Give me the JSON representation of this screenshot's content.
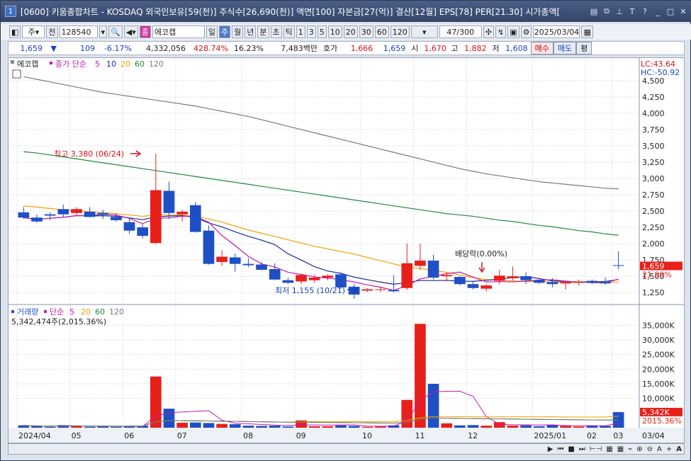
{
  "window": {
    "number": "1",
    "title": "[0600] 키움종합차트 - KOSDAQ 외국인보유[59(천)] 주식수[26,690(천)] 액면[100] 자본금[27(억)] 결산[12월] EPS[78] PER[21.30] 시가총액[",
    "buttons": [
      "doc-icon",
      "restore-icon",
      "pin-icon",
      "T",
      "?",
      "_",
      "□",
      "×"
    ]
  },
  "toolbar": {
    "period_type": "주",
    "prev": "전",
    "code": "128540",
    "name": "에코캡",
    "name_tag": "종",
    "intervals": [
      "일",
      "주",
      "월",
      "년"
    ],
    "selected_interval": "주",
    "minute_types": [
      "분",
      "초",
      "틱"
    ],
    "numbers": [
      "1",
      "3",
      "5",
      "10",
      "20",
      "30",
      "60",
      "120"
    ],
    "count": "47",
    "count_total": "/300",
    "date": "2025/03/04"
  },
  "info": {
    "price": "1,659",
    "arrow": "▼",
    "change": "109",
    "change_pct": "-6.17%",
    "volume": "4,332,056",
    "vol_pct": "428.74%",
    "turnover": "16.23%",
    "amount": "7,483백만",
    "hoga_label": "호가",
    "hoga1": "1,666",
    "hoga2": "1,659",
    "open_label": "시",
    "open": "1,670",
    "high_label": "고",
    "high": "1,882",
    "low_label": "저",
    "low": "1,608",
    "buy": "매수",
    "sell": "매도",
    "eval": "평"
  },
  "price_panel": {
    "name": "에코캡",
    "ma_label": "종가 단순",
    "ma_periods": [
      "5",
      "10",
      "20",
      "60",
      "120"
    ],
    "lc": "LC:43.64",
    "hc": "HC:-50.92",
    "high_note": "최고 3,380 (06/24)",
    "low_note": "최저 1,155 (10/21)",
    "dividend_note": "배당락(0.00%)",
    "current_price": "1,659",
    "current_pct": "21.99%",
    "ticks": [
      "4,500",
      "4,250",
      "4,000",
      "3,750",
      "3,500",
      "3,250",
      "3,000",
      "2,750",
      "2,500",
      "2,250",
      "2,000",
      "1,750",
      "1,500",
      "1,250"
    ]
  },
  "volume_panel": {
    "label": "거래량",
    "ma_label": "단순",
    "ma_periods": [
      "5",
      "20",
      "60",
      "120"
    ],
    "value_text": "5,342,474주(2,015.36%)",
    "current": "5,342K",
    "current_pct": "2015.36%",
    "ticks": [
      "35,000K",
      "30,000K",
      "25,000K",
      "20,000K",
      "15,000K",
      "10,000K"
    ]
  },
  "xaxis": {
    "labels": [
      "2024/04",
      "05",
      "06",
      "07",
      "08",
      "09",
      "10",
      "11",
      "12",
      "2025/01",
      "02",
      "03"
    ],
    "last": "03/04"
  },
  "colors": {
    "up": "#e8201a",
    "down": "#1f4fc4",
    "ma5": "#c21ab0",
    "ma10": "#1a2a9c",
    "ma20": "#f0a000",
    "ma60": "#1f8a3a",
    "ma120": "#7a7a7a"
  },
  "chart_data": {
    "type": "candlestick",
    "candles": [
      [
        2480,
        2560,
        2380,
        2400
      ],
      [
        2400,
        2450,
        2320,
        2340
      ],
      [
        2450,
        2480,
        2360,
        2430
      ],
      [
        2530,
        2600,
        2400,
        2450
      ],
      [
        2470,
        2560,
        2420,
        2530
      ],
      [
        2490,
        2560,
        2400,
        2410
      ],
      [
        2470,
        2520,
        2380,
        2440
      ],
      [
        2410,
        2460,
        2340,
        2360
      ],
      [
        2330,
        2380,
        2150,
        2200
      ],
      [
        2250,
        2300,
        2080,
        2120
      ],
      [
        2010,
        3380,
        1990,
        2820
      ],
      [
        2810,
        2950,
        2380,
        2470
      ],
      [
        2450,
        2520,
        2340,
        2490
      ],
      [
        2590,
        2640,
        2170,
        2180
      ],
      [
        2200,
        2280,
        1680,
        1690
      ],
      [
        1720,
        1900,
        1660,
        1800
      ],
      [
        1790,
        1850,
        1570,
        1690
      ],
      [
        1690,
        1780,
        1640,
        1670
      ],
      [
        1680,
        1720,
        1590,
        1600
      ],
      [
        1610,
        1700,
        1440,
        1450
      ],
      [
        1440,
        1480,
        1380,
        1400
      ],
      [
        1420,
        1540,
        1380,
        1520
      ],
      [
        1440,
        1530,
        1400,
        1480
      ],
      [
        1480,
        1530,
        1440,
        1510
      ],
      [
        1530,
        1560,
        1310,
        1330
      ],
      [
        1340,
        1380,
        1155,
        1220
      ],
      [
        1280,
        1320,
        1260,
        1300
      ],
      [
        1290,
        1340,
        1260,
        1300
      ],
      [
        1290,
        1520,
        1250,
        1270
      ],
      [
        1320,
        2000,
        1290,
        1700
      ],
      [
        1660,
        2000,
        1600,
        1740
      ],
      [
        1740,
        1830,
        1450,
        1480
      ],
      [
        1500,
        1550,
        1420,
        1520
      ],
      [
        1490,
        1500,
        1360,
        1380
      ],
      [
        1380,
        1430,
        1300,
        1320
      ],
      [
        1310,
        1380,
        1270,
        1360
      ],
      [
        1430,
        1600,
        1380,
        1510
      ],
      [
        1470,
        1650,
        1440,
        1500
      ],
      [
        1500,
        1560,
        1380,
        1440
      ],
      [
        1440,
        1450,
        1380,
        1400
      ],
      [
        1410,
        1470,
        1330,
        1380
      ],
      [
        1390,
        1430,
        1300,
        1410
      ],
      [
        1400,
        1450,
        1360,
        1420
      ],
      [
        1430,
        1450,
        1380,
        1400
      ],
      [
        1410,
        1480,
        1370,
        1390
      ],
      [
        1670,
        1882,
        1608,
        1659
      ]
    ],
    "volume_k": [
      800,
      500,
      300,
      900,
      700,
      300,
      400,
      300,
      600,
      700,
      17500,
      6500,
      1700,
      1800,
      1600,
      1300,
      1200,
      700,
      600,
      700,
      400,
      2500,
      500,
      500,
      800,
      600,
      300,
      400,
      800,
      9500,
      35500,
      15000,
      1500,
      800,
      900,
      700,
      1900,
      700,
      800,
      500,
      1000,
      600,
      400,
      800,
      600,
      5342
    ],
    "ma20": [
      2580,
      2560,
      2540,
      2520,
      2500,
      2490,
      2475,
      2460,
      2440,
      2420,
      2440,
      2440,
      2440,
      2420,
      2380,
      2330,
      2270,
      2210,
      2160,
      2110,
      2060,
      2010,
      1960,
      1920,
      1880,
      1840,
      1790,
      1740,
      1690,
      1640,
      1620,
      1590,
      1560,
      1520,
      1480,
      1450,
      1440,
      1430,
      1420,
      1420,
      1410,
      1410,
      1410,
      1410,
      1410,
      1410
    ],
    "ma60": [
      3410,
      3390,
      3360,
      3330,
      3300,
      3270,
      3240,
      3210,
      3180,
      3150,
      3120,
      3090,
      3060,
      3030,
      3000,
      2970,
      2940,
      2910,
      2880,
      2850,
      2820,
      2790,
      2760,
      2730,
      2700,
      2670,
      2640,
      2610,
      2580,
      2550,
      2520,
      2490,
      2460,
      2440,
      2420,
      2390,
      2360,
      2340,
      2310,
      2280,
      2260,
      2230,
      2200,
      2180,
      2150,
      2130
    ],
    "ma120": [
      4560,
      4520,
      4480,
      4440,
      4400,
      4360,
      4320,
      4290,
      4260,
      4230,
      4200,
      4170,
      4140,
      4110,
      4070,
      4030,
      3990,
      3950,
      3900,
      3850,
      3800,
      3750,
      3700,
      3650,
      3600,
      3550,
      3500,
      3450,
      3400,
      3350,
      3300,
      3250,
      3200,
      3150,
      3110,
      3070,
      3040,
      3010,
      2980,
      2950,
      2930,
      2910,
      2890,
      2870,
      2850,
      2840
    ],
    "ylim": [
      1100,
      4650
    ],
    "vol_ylim": [
      0,
      38000
    ]
  }
}
